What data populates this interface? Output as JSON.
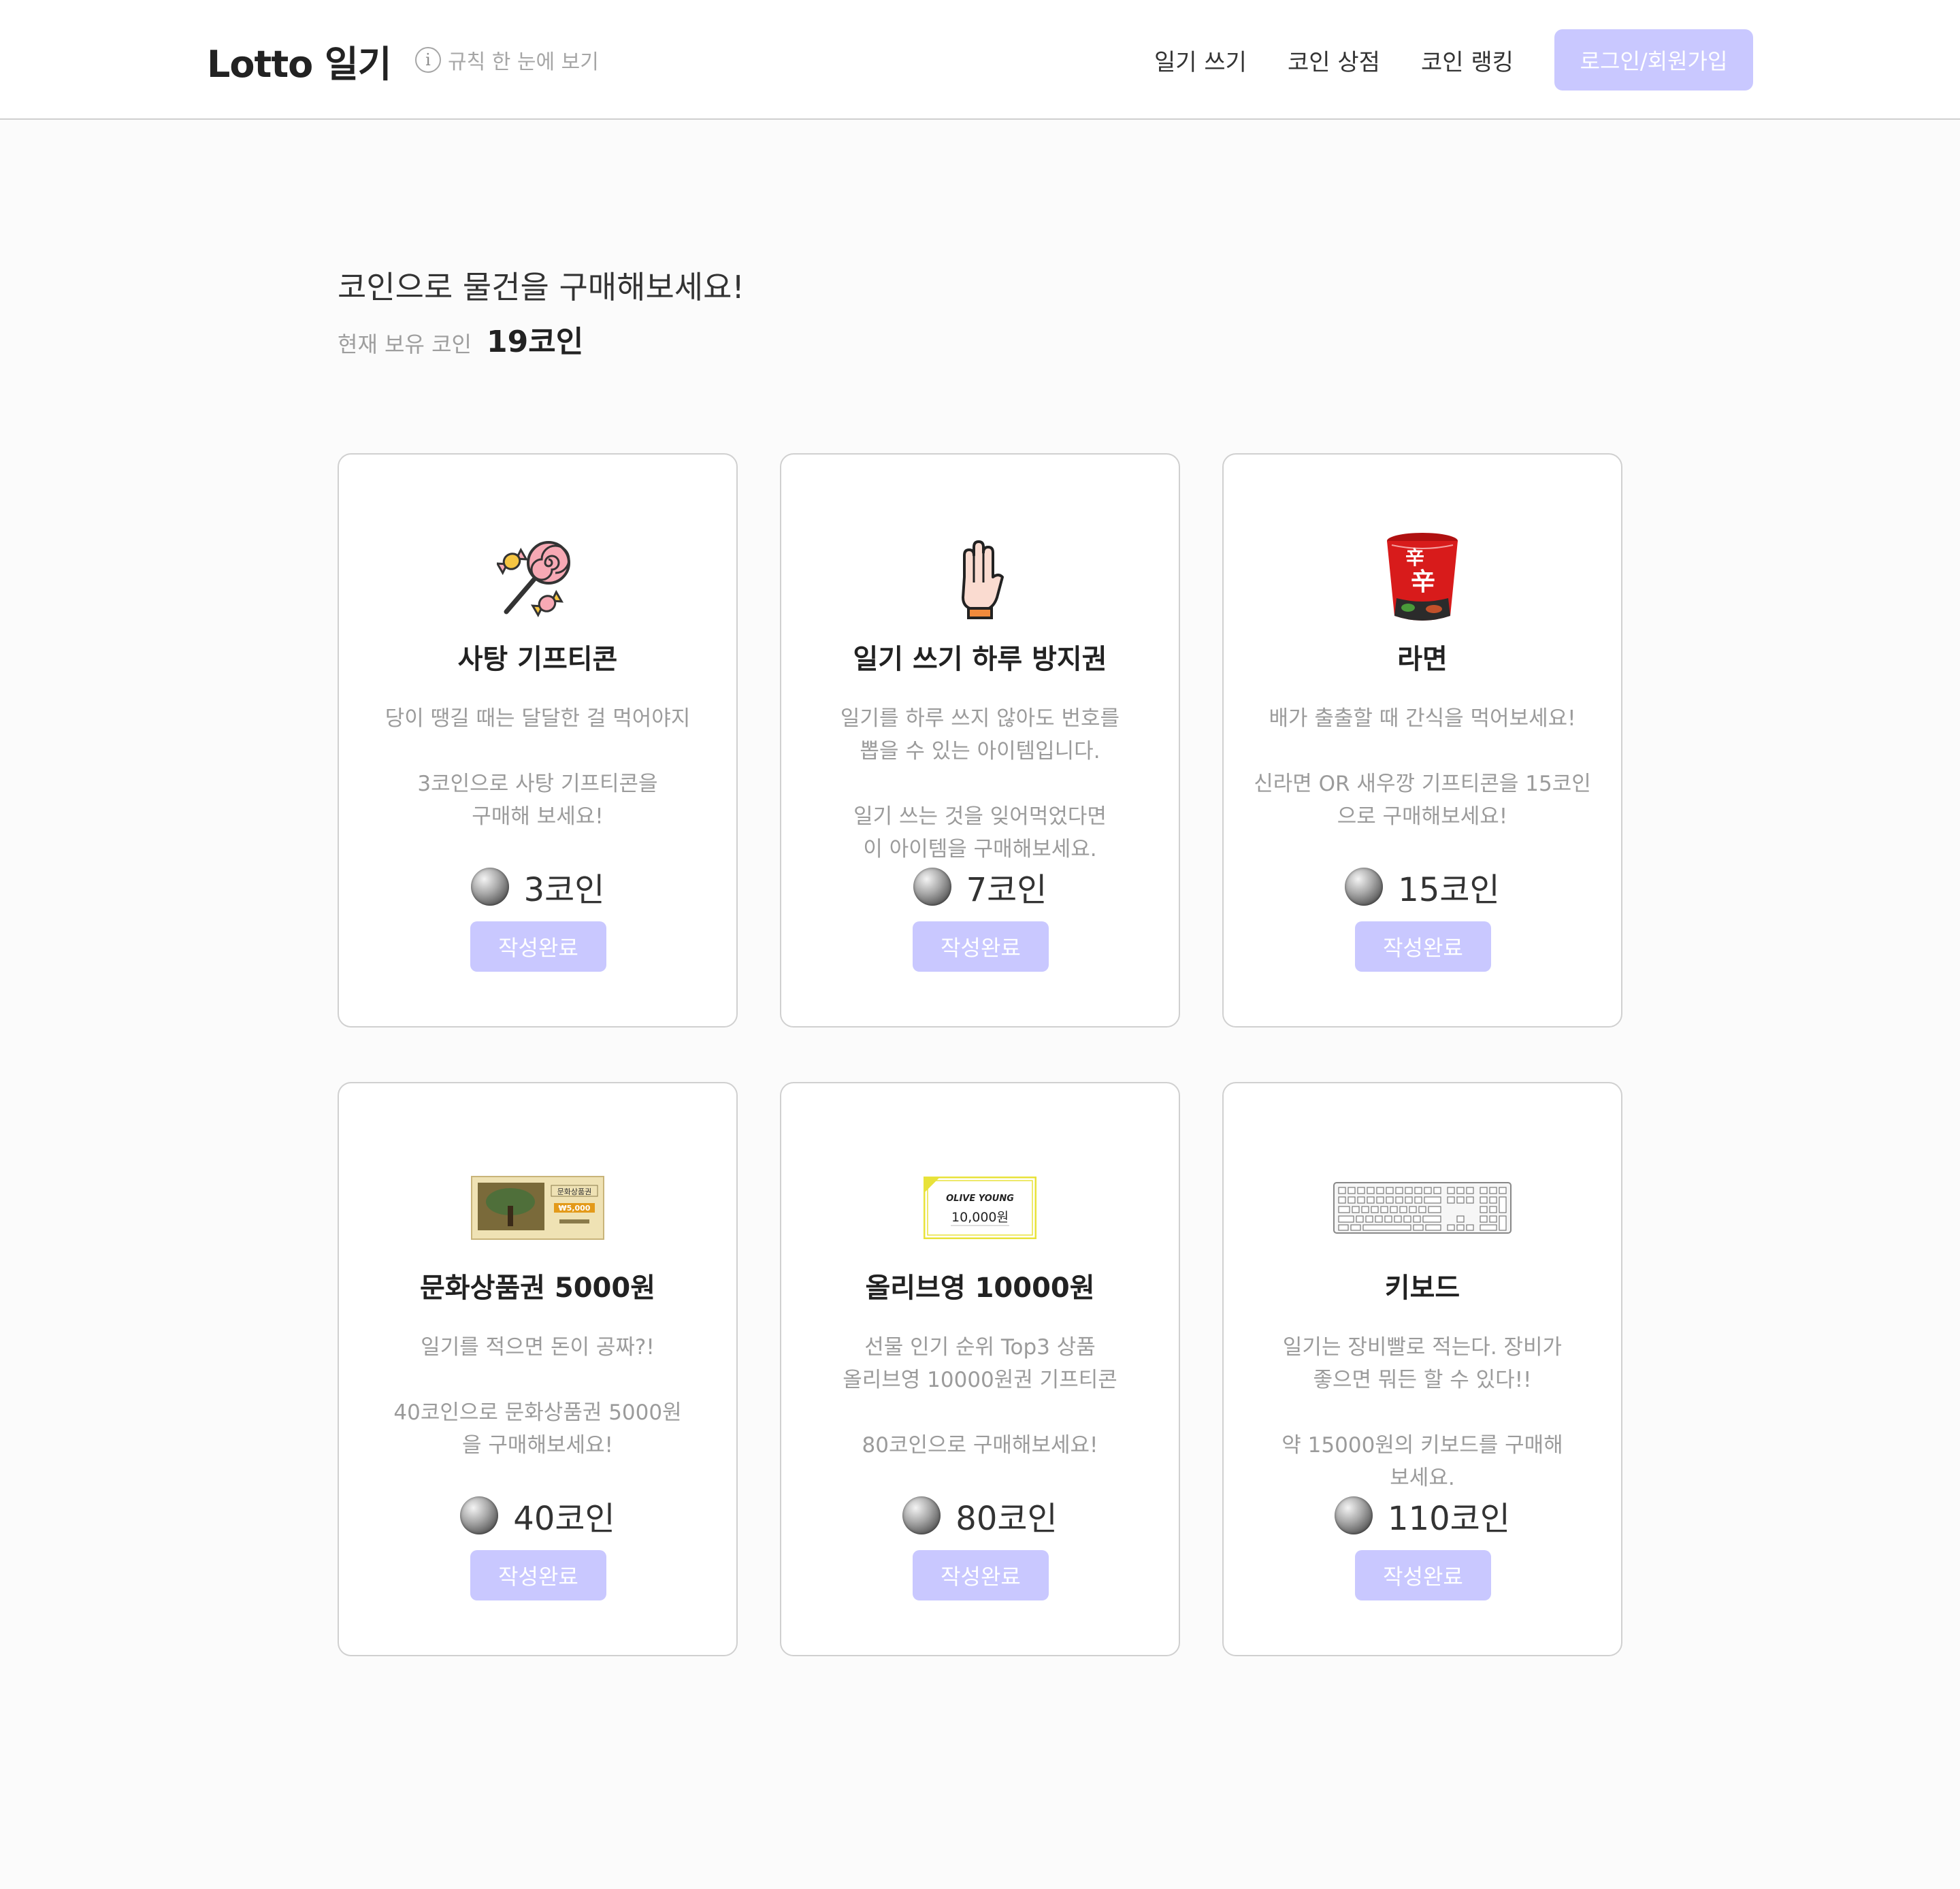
{
  "header": {
    "logo": "Lotto 일기",
    "rules_link": "규칙 한 눈에 보기",
    "nav": [
      "일기 쓰기",
      "코인 상점",
      "코인 랭킹"
    ],
    "login_button": "로그인/회원가입"
  },
  "main": {
    "title": "코인으로 물건을 구매해보세요!",
    "coin_label": "현재 보유 코인",
    "coin_value": "19코인"
  },
  "products": [
    {
      "name": "사탕 기프티콘",
      "desc": [
        "당이 땡길 때는 달달한 걸 먹어야지",
        "",
        "3코인으로 사탕 기프티콘을",
        "구매해 보세요!"
      ],
      "price": "3코인",
      "button": "작성완료",
      "icon": "candy-icon"
    },
    {
      "name": "일기 쓰기 하루 방지권",
      "desc": [
        "일기를 하루 쓰지 않아도 번호를",
        "뽑을 수 있는 아이템입니다.",
        "",
        "일기 쓰는 것을 잊어먹었다면",
        "이 아이템을 구매해보세요."
      ],
      "price": "7코인",
      "button": "작성완료",
      "icon": "hand-icon"
    },
    {
      "name": "라면",
      "desc": [
        "배가 출출할 때 간식을 먹어보세요!",
        "",
        "신라면 OR 새우깡 기프티콘을 15코인",
        "으로 구매해보세요!"
      ],
      "price": "15코인",
      "button": "작성완료",
      "icon": "ramen-cup-icon"
    },
    {
      "name": "문화상품권 5000원",
      "desc": [
        "일기를 적으면 돈이 공짜?!",
        "",
        "40코인으로 문화상품권 5000원",
        "을 구매해보세요!"
      ],
      "price": "40코인",
      "button": "작성완료",
      "icon": "gift-voucher-icon",
      "voucher_text": [
        "문화상품권",
        "₩5,000"
      ]
    },
    {
      "name": "올리브영 10000원",
      "desc": [
        "선물 인기 순위 Top3 상품",
        "올리브영 10000원권 기프티콘",
        "",
        "80코인으로 구매해보세요!"
      ],
      "price": "80코인",
      "button": "작성완료",
      "icon": "oliveyoung-voucher-icon",
      "voucher_text": [
        "OLIVE YOUNG",
        "10,000원"
      ]
    },
    {
      "name": "키보드",
      "desc": [
        "일기는 장비빨로 적는다. 장비가",
        "좋으면 뭐든 할 수 있다!!",
        "",
        "약 15000원의 키보드를 구매해",
        "보세요."
      ],
      "price": "110코인",
      "button": "작성완료",
      "icon": "keyboard-icon"
    }
  ],
  "colors": {
    "accent": "#c9c8ff",
    "background": "#fbfbfb",
    "card_border": "#d0d0d0",
    "text_dark": "#222222",
    "text_muted": "#9b9b9b"
  }
}
